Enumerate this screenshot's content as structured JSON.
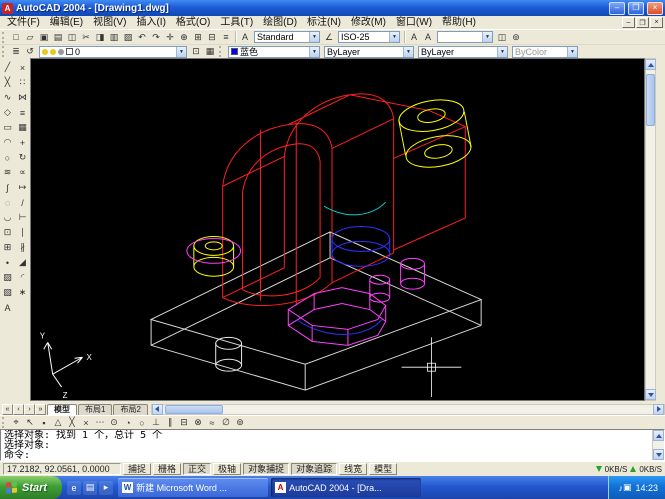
{
  "window": {
    "title": "AutoCAD 2004 - [Drawing1.dwg]"
  },
  "icons": {
    "app": "A",
    "minimize": "–",
    "maximize": "❐",
    "close": "×",
    "combo_arrow": "▼"
  },
  "menubar": {
    "items": [
      {
        "id": "file",
        "label": "文件(F)"
      },
      {
        "id": "edit",
        "label": "编辑(E)"
      },
      {
        "id": "view",
        "label": "视图(V)"
      },
      {
        "id": "insert",
        "label": "插入(I)"
      },
      {
        "id": "format",
        "label": "格式(O)"
      },
      {
        "id": "tools",
        "label": "工具(T)"
      },
      {
        "id": "draw",
        "label": "绘图(D)"
      },
      {
        "id": "dimension",
        "label": "标注(N)"
      },
      {
        "id": "modify",
        "label": "修改(M)"
      },
      {
        "id": "window",
        "label": "窗口(W)"
      },
      {
        "id": "help",
        "label": "帮助(H)"
      }
    ]
  },
  "toolbar_row1": {
    "standard_icons": [
      {
        "id": "new",
        "glyph": "□"
      },
      {
        "id": "open",
        "glyph": "▱"
      },
      {
        "id": "save",
        "glyph": "▣"
      },
      {
        "id": "plot",
        "glyph": "▤"
      },
      {
        "id": "plot-preview",
        "glyph": "◫"
      },
      {
        "id": "cut",
        "glyph": "✂"
      },
      {
        "id": "copy",
        "glyph": "◨"
      },
      {
        "id": "paste",
        "glyph": "▥"
      },
      {
        "id": "match-properties",
        "glyph": "▨"
      },
      {
        "id": "undo",
        "glyph": "↶"
      },
      {
        "id": "redo",
        "glyph": "↷"
      },
      {
        "id": "pan",
        "glyph": "✛"
      },
      {
        "id": "zoom-realtime",
        "glyph": "⊕"
      },
      {
        "id": "zoom-window",
        "glyph": "⊞"
      },
      {
        "id": "zoom-previous",
        "glyph": "⊟"
      },
      {
        "id": "properties",
        "glyph": "≡"
      }
    ],
    "text_style_icon": "A",
    "text_style": "Standard",
    "dim_style_icon": "∠",
    "dim_style": "ISO-25",
    "letter_buttons": [
      {
        "id": "mtext",
        "glyph": "A"
      },
      {
        "id": "dtext",
        "glyph": "A"
      }
    ],
    "extra_combo": "",
    "right_icons": [
      {
        "id": "named-views",
        "glyph": "◫"
      },
      {
        "id": "3d-orbit",
        "glyph": "⊚"
      }
    ]
  },
  "toolbar_row2": {
    "left_icons": [
      {
        "id": "layer-properties-manager",
        "glyph": "≣"
      },
      {
        "id": "layer-previous",
        "glyph": "↺"
      }
    ],
    "layer_name": "0",
    "mid_icons": [
      {
        "id": "make-object-layer-current",
        "glyph": "⊡"
      },
      {
        "id": "layer-states",
        "glyph": "▦"
      }
    ],
    "color": "蓝色",
    "linetype": "ByLayer",
    "lineweight": "ByLayer",
    "plot_style": "ByColor"
  },
  "draw_toolbar": [
    {
      "id": "line",
      "glyph": "╱"
    },
    {
      "id": "construction-line",
      "glyph": "╳"
    },
    {
      "id": "polyline",
      "glyph": "∿"
    },
    {
      "id": "polygon",
      "glyph": "◇"
    },
    {
      "id": "rectangle",
      "glyph": "▭"
    },
    {
      "id": "arc",
      "glyph": "◠"
    },
    {
      "id": "circle",
      "glyph": "○"
    },
    {
      "id": "revision-cloud",
      "glyph": "≋"
    },
    {
      "id": "spline",
      "glyph": "∫"
    },
    {
      "id": "ellipse",
      "glyph": "◌"
    },
    {
      "id": "ellipse-arc",
      "glyph": "◡"
    },
    {
      "id": "insert-block",
      "glyph": "⊡"
    },
    {
      "id": "make-block",
      "glyph": "⊞"
    },
    {
      "id": "point",
      "glyph": "•"
    },
    {
      "id": "hatch",
      "glyph": "▨"
    },
    {
      "id": "region",
      "glyph": "▧"
    },
    {
      "id": "multiline-text",
      "glyph": "A"
    }
  ],
  "modify_toolbar": [
    {
      "id": "erase",
      "glyph": "×"
    },
    {
      "id": "copy-object",
      "glyph": "∷"
    },
    {
      "id": "mirror",
      "glyph": "⋈"
    },
    {
      "id": "offset",
      "glyph": "≡"
    },
    {
      "id": "array",
      "glyph": "▦"
    },
    {
      "id": "move",
      "glyph": "+"
    },
    {
      "id": "rotate",
      "glyph": "↻"
    },
    {
      "id": "scale",
      "glyph": "∝"
    },
    {
      "id": "stretch",
      "glyph": "↦"
    },
    {
      "id": "trim",
      "glyph": "/"
    },
    {
      "id": "extend",
      "glyph": "⊢"
    },
    {
      "id": "break-at-point",
      "glyph": "∣"
    },
    {
      "id": "break",
      "glyph": "∦"
    },
    {
      "id": "chamfer",
      "glyph": "◢"
    },
    {
      "id": "fillet",
      "glyph": "◜"
    },
    {
      "id": "explode",
      "glyph": "∗"
    }
  ],
  "osnap_toolbar": [
    {
      "id": "temporary-track-point",
      "glyph": "⌖"
    },
    {
      "id": "snap-from",
      "glyph": "↖"
    },
    {
      "id": "snap-to-endpoint",
      "glyph": "▪"
    },
    {
      "id": "snap-to-midpoint",
      "glyph": "△"
    },
    {
      "id": "snap-to-intersection",
      "glyph": "╳"
    },
    {
      "id": "snap-to-apparent-intersection",
      "glyph": "×"
    },
    {
      "id": "snap-to-extension",
      "glyph": "⋯"
    },
    {
      "id": "snap-to-center",
      "glyph": "⊙"
    },
    {
      "id": "snap-to-quadrant",
      "glyph": "◔"
    },
    {
      "id": "snap-to-tangent",
      "glyph": "○"
    },
    {
      "id": "snap-to-perpendicular",
      "glyph": "⊥"
    },
    {
      "id": "snap-to-parallel",
      "glyph": "∥"
    },
    {
      "id": "snap-to-insert",
      "glyph": "⊟"
    },
    {
      "id": "snap-to-node",
      "glyph": "⊗"
    },
    {
      "id": "snap-to-nearest",
      "glyph": "≈"
    },
    {
      "id": "snap-to-none",
      "glyph": "∅"
    },
    {
      "id": "osnap-settings",
      "glyph": "⊚"
    }
  ],
  "tabs": {
    "nav": [
      {
        "id": "first",
        "glyph": "«"
      },
      {
        "id": "prev",
        "glyph": "‹"
      },
      {
        "id": "next",
        "glyph": "›"
      },
      {
        "id": "last",
        "glyph": "»"
      }
    ],
    "items": [
      {
        "id": "model",
        "label": "模型",
        "active": true
      },
      {
        "id": "layout1",
        "label": "布局1",
        "active": false
      },
      {
        "id": "layout2",
        "label": "布局2",
        "active": false
      }
    ]
  },
  "command": {
    "lines": [
      "选择对象: 找到 1 个，总计 5 个",
      "选择对象:",
      "命令:"
    ]
  },
  "status": {
    "coordinates": "17.2182, 92.0561, 0.0000",
    "toggles": [
      {
        "id": "snap",
        "label": "捕捉",
        "pressed": false
      },
      {
        "id": "grid",
        "label": "栅格",
        "pressed": false
      },
      {
        "id": "ortho",
        "label": "正交",
        "pressed": true
      },
      {
        "id": "polar",
        "label": "极轴",
        "pressed": false
      },
      {
        "id": "osnap",
        "label": "对象捕捉",
        "pressed": true
      },
      {
        "id": "otrack",
        "label": "对象追踪",
        "pressed": true
      },
      {
        "id": "lwt",
        "label": "线宽",
        "pressed": false
      },
      {
        "id": "model",
        "label": "模型",
        "pressed": false
      }
    ],
    "net_down": "0KB/S",
    "net_up": "0KB/S"
  },
  "ucs": {
    "x": "X",
    "y": "Y",
    "z": "Z"
  },
  "taskbar": {
    "start_label": "Start",
    "quick_launch": [
      {
        "id": "internet-explorer",
        "glyph": "e"
      },
      {
        "id": "show-desktop",
        "glyph": "▤"
      },
      {
        "id": "media-player",
        "glyph": "▸"
      }
    ],
    "tasks": [
      {
        "id": "word-document",
        "icon_letter": "W",
        "label": "新建 Microsoft Word ...",
        "active": false
      },
      {
        "id": "autocad",
        "icon_letter": "A",
        "label": "AutoCAD 2004 - [Dra...",
        "active": true
      }
    ],
    "tray_icons": [
      {
        "id": "volume",
        "glyph": "♪"
      },
      {
        "id": "network",
        "glyph": "▣"
      }
    ],
    "time": "14:23"
  },
  "colors": {
    "titlebar_blue": "#1e5cd6",
    "taskbar_blue": "#2258cf",
    "start_green": "#3d9f35",
    "canvas_black": "#000000",
    "wire_red": "#ff2020",
    "wire_yellow": "#ffff00",
    "wire_magenta": "#ff40ff",
    "wire_blue": "#3030ff",
    "wire_cyan": "#00cccc",
    "wire_white": "#e8e8e8",
    "current_color": "#0000ff"
  }
}
